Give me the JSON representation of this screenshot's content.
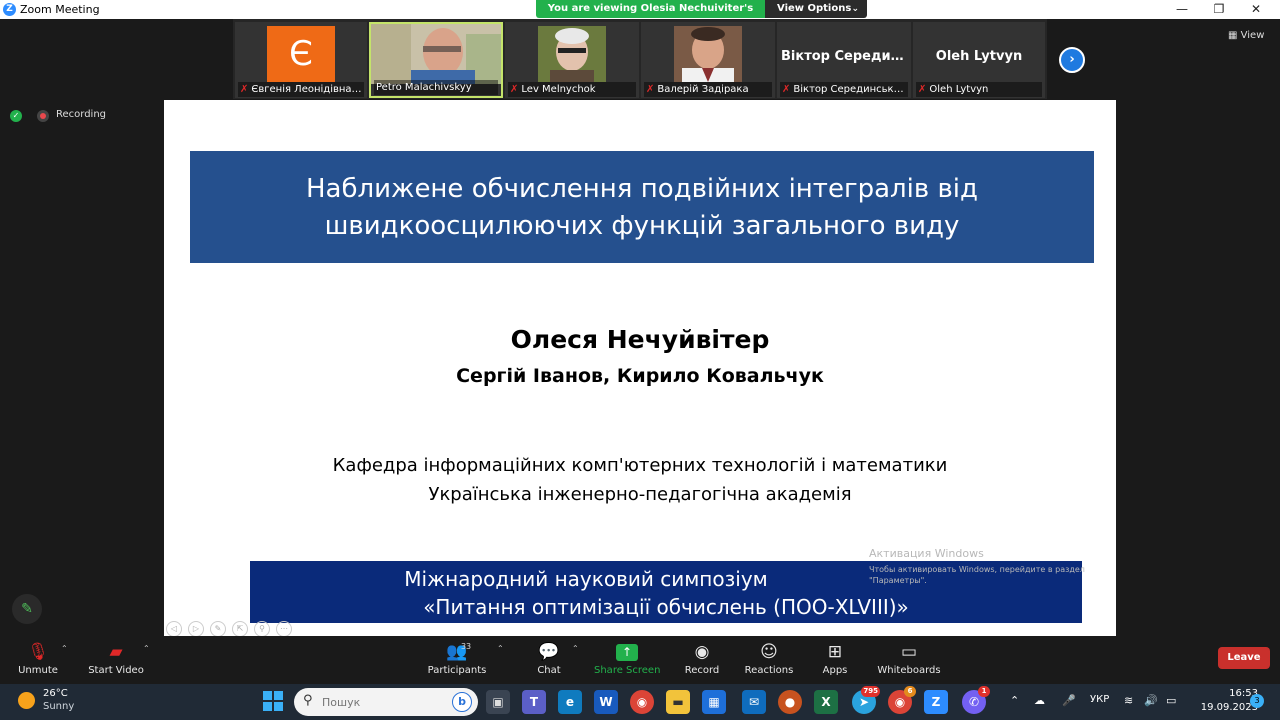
{
  "window": {
    "title": "Zoom Meeting",
    "minimize": "—",
    "maximize": "❐",
    "close": "✕"
  },
  "share": {
    "banner": "You are viewing Olesia Nechuiviter's screen",
    "view_options": "View Options"
  },
  "view_button": "View",
  "recording_label": "Recording",
  "participants_strip": [
    {
      "name": "Євгенія Леонідівна Ху...",
      "muted": true,
      "avatar": "Є",
      "color": "#ef6a16"
    },
    {
      "name": "Petro Malachivskyy",
      "muted": false
    },
    {
      "name": "Lev Melnychok",
      "muted": true
    },
    {
      "name": "Валерій Задірака",
      "muted": true
    },
    {
      "name": "Віктор Серединський",
      "muted": true,
      "display": "Віктор Середин..."
    },
    {
      "name": "Oleh Lytvyn",
      "muted": true,
      "display": "Oleh Lytvyn"
    }
  ],
  "slide": {
    "title_line1": "Наближене обчислення подвійних інтегралів від",
    "title_line2": "швидкоосцилюючих функцій загального виду",
    "author_main": "Олеся Нечуйвітер",
    "coauthors": "Сергій Іванов, Кирило Ковальчук",
    "affiliation1": "Кафедра інформаційних комп'ютерних технологій і математики",
    "affiliation2": "Українська інженерно-педагогічна академія",
    "symposium1": "Міжнародний науковий симпозіум",
    "symposium2": "«Питання оптимізації обчислень (ПОО-XLVIII)»",
    "watermark_title": "Активация Windows",
    "watermark_sub": "Чтобы активировать Windows, перейдите в раздел \"Параметры\"."
  },
  "toolbar": {
    "unmute": "Unmute",
    "start_video": "Start Video",
    "participants": "Participants",
    "participants_count": "33",
    "chat": "Chat",
    "share_screen": "Share Screen",
    "record": "Record",
    "reactions": "Reactions",
    "apps": "Apps",
    "whiteboards": "Whiteboards",
    "leave": "Leave"
  },
  "taskbar": {
    "temperature": "26°C",
    "condition": "Sunny",
    "search_placeholder": "Пошук",
    "badge_telegram": "795",
    "badge_chrome": "6",
    "badge_viber": "1",
    "lang": "УКР",
    "time": "16:53",
    "date": "19.09.2023",
    "notifications": "3"
  }
}
